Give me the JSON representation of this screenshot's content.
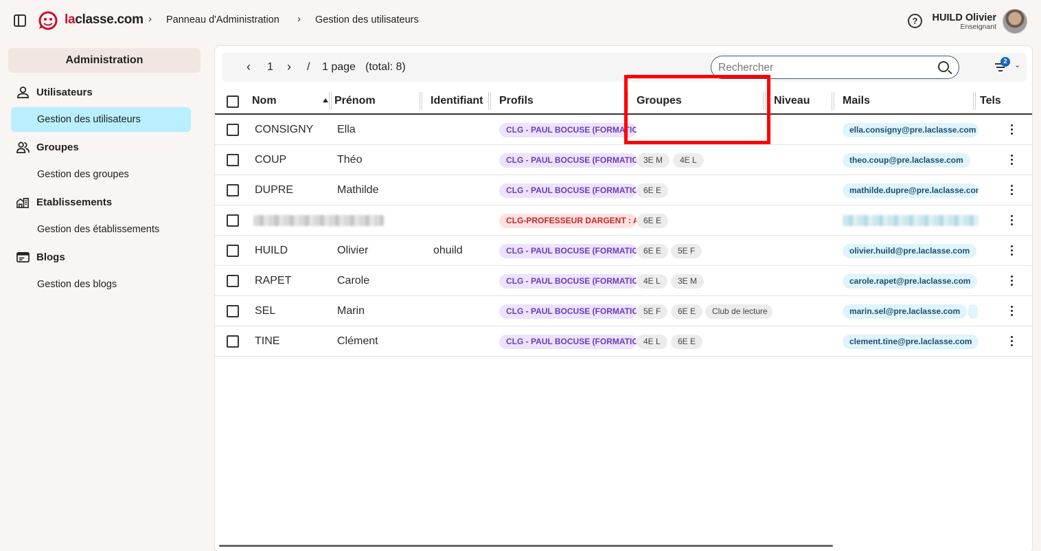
{
  "header": {
    "brand_prefix": "la",
    "brand_suffix": "classe.com",
    "breadcrumb": [
      "Panneau d'Administration",
      "Gestion des utilisateurs"
    ],
    "user": {
      "name": "HUILD Olivier",
      "role": "Enseignant"
    }
  },
  "sidebar": {
    "title": "Administration",
    "sections": [
      {
        "label": "Utilisateurs",
        "item": "Gestion des utilisateurs",
        "active": true
      },
      {
        "label": "Groupes",
        "item": "Gestion des groupes",
        "active": false
      },
      {
        "label": "Etablissements",
        "item": "Gestion des établissements",
        "active": false
      },
      {
        "label": "Blogs",
        "item": "Gestion des blogs",
        "active": false
      }
    ]
  },
  "toolbar": {
    "page": "1",
    "separator": "/",
    "pages_text": "1 page",
    "total_text": "(total: 8)",
    "search_placeholder": "Rechercher",
    "filter_count": "2"
  },
  "table": {
    "columns": [
      "Nom",
      "Prénom",
      "Identifiant",
      "Profils",
      "Groupes",
      "Niveau",
      "Mails",
      "Tels"
    ],
    "rows": [
      {
        "nom": "CONSIGNY",
        "prenom": "Ella",
        "identifiant": "",
        "profil": "CLG - PAUL BOCUSE (FORMATION)",
        "groupes": [],
        "mail": "ella.consigny@pre.laclasse.com"
      },
      {
        "nom": "COUP",
        "prenom": "Théo",
        "identifiant": "",
        "profil": "CLG - PAUL BOCUSE (FORMATION)",
        "groupes": [
          "3E M",
          "4E L"
        ],
        "mail": "theo.coup@pre.laclasse.com"
      },
      {
        "nom": "DUPRE",
        "prenom": "Mathilde",
        "identifiant": "",
        "profil": "CLG - PAUL BOCUSE (FORMATION)",
        "groupes": [
          "6E E"
        ],
        "mail": "mathilde.dupre@pre.laclasse.com"
      },
      {
        "nom": "",
        "prenom": "",
        "identifiant": "",
        "profil": "CLG-PROFESSEUR DARGENT : A",
        "groupes": [
          "6E E"
        ],
        "mail": ""
      },
      {
        "nom": "HUILD",
        "prenom": "Olivier",
        "identifiant": "ohuild",
        "profil": "CLG - PAUL BOCUSE (FORMATION)",
        "groupes": [
          "6E E",
          "5E F"
        ],
        "mail": "olivier.huild@pre.laclasse.com"
      },
      {
        "nom": "RAPET",
        "prenom": "Carole",
        "identifiant": "",
        "profil": "CLG - PAUL BOCUSE (FORMATION)",
        "groupes": [
          "4E L",
          "3E M"
        ],
        "mail": "carole.rapet@pre.laclasse.com"
      },
      {
        "nom": "SEL",
        "prenom": "Marin",
        "identifiant": "",
        "profil": "CLG - PAUL BOCUSE (FORMATION)",
        "groupes": [
          "5E F",
          "6E E",
          "Club de lecture"
        ],
        "mail": "marin.sel@pre.laclasse.com"
      },
      {
        "nom": "TINE",
        "prenom": "Clément",
        "identifiant": "",
        "profil": "CLG - PAUL BOCUSE (FORMATION)",
        "groupes": [
          "4E L",
          "6E E"
        ],
        "mail": "clement.tine@pre.laclasse.com"
      }
    ]
  },
  "colors": {
    "accent_red": "#c8102e",
    "active_item": "#b9efff",
    "profile_chip": "#ede2ff",
    "mail_chip": "#dff4fb",
    "highlight": "#ff0000"
  }
}
